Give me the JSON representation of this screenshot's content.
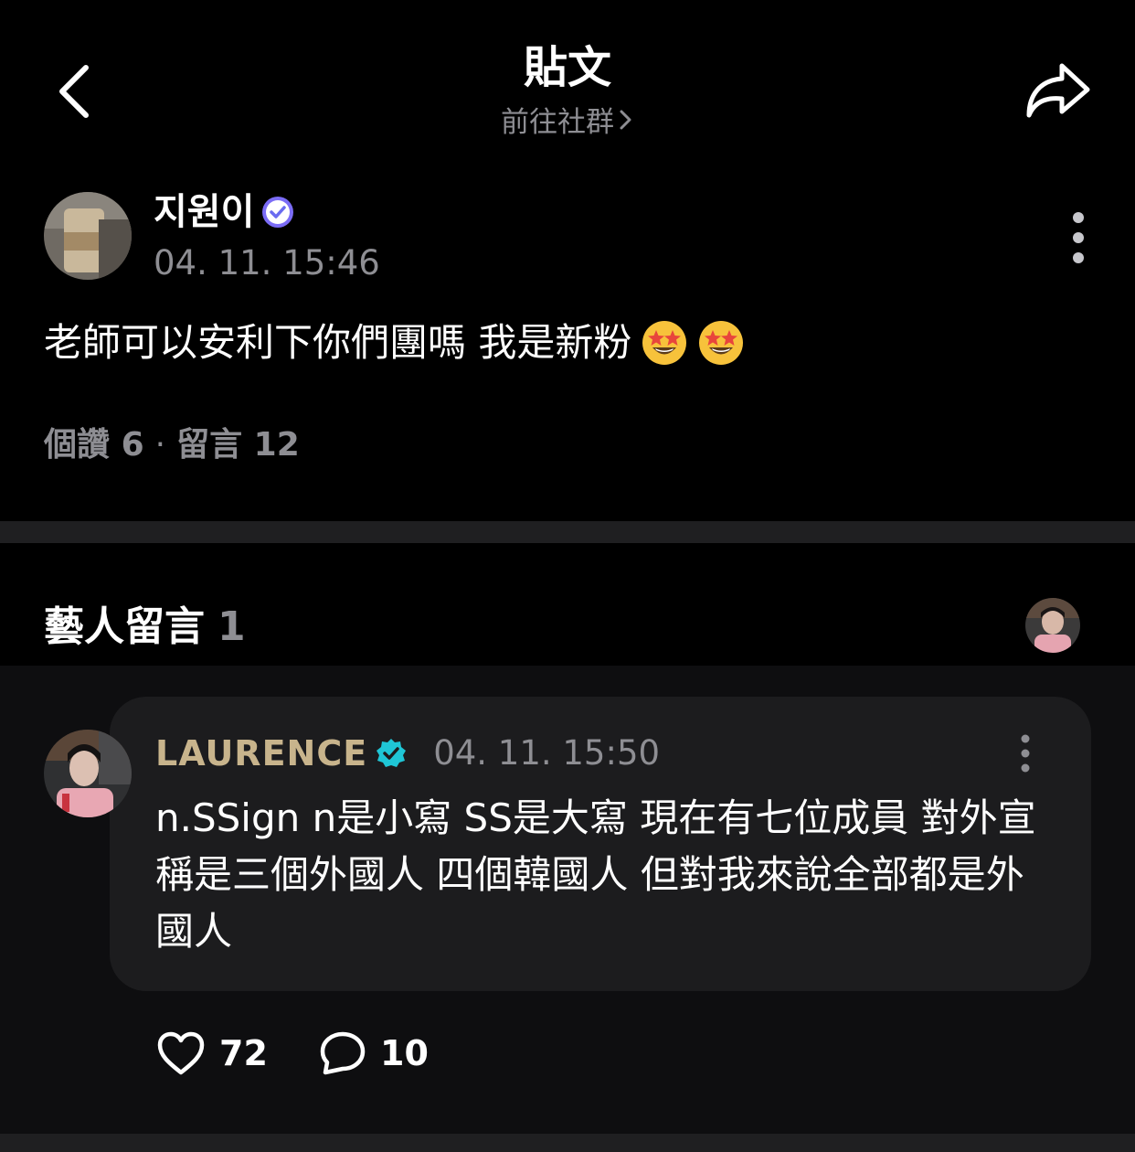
{
  "header": {
    "title": "貼文",
    "community_link": "前往社群",
    "icons": {
      "back": "back-chevron-icon",
      "share": "share-arrow-icon"
    }
  },
  "post": {
    "author": "지원이",
    "timestamp": "04. 11. 15:46",
    "body": "老師可以安利下你們團嗎 我是新粉",
    "emoji": "star-struck-emoji",
    "likes_label": "個讚",
    "likes_count": "6",
    "comments_label": "留言",
    "comments_count": "12"
  },
  "artist_comments": {
    "title": "藝人留言",
    "count": "1",
    "comment": {
      "author": "LAURENCE",
      "timestamp": "04. 11. 15:50",
      "text": "n.SSign n是小寫 SS是大寫 現在有七位成員 對外宣稱是三個外國人 四個韓國人 但對我來說全部都是外國人",
      "likes": "72",
      "replies": "10"
    }
  },
  "colors": {
    "background": "#000000",
    "secondary_text": "#8e8e93",
    "artist_name": "#c8b48c",
    "card": "#1c1c1e",
    "verified_badge": "#7b6cf6",
    "artist_badge": "#1fc6d6"
  }
}
